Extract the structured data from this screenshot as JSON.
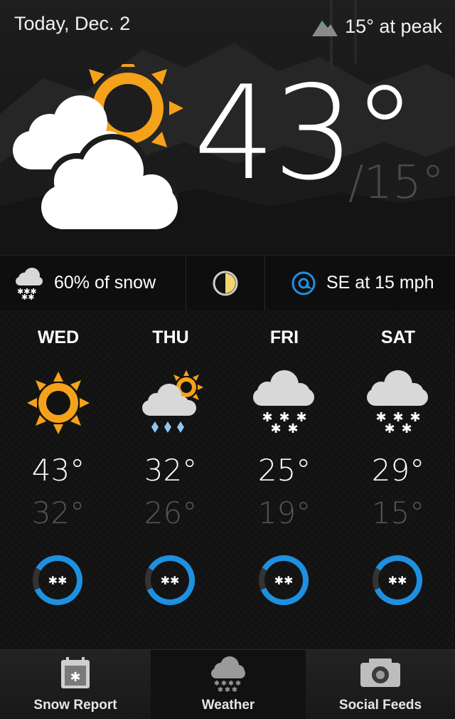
{
  "header": {
    "date": "Today, Dec. 2",
    "peak": "15° at peak",
    "peak_icon": "mountain-icon"
  },
  "current": {
    "condition_icon": "partly-cloudy-icon",
    "high": "43°",
    "low": "/15°"
  },
  "stats": {
    "snow_chance": "60% of snow",
    "snow_icon": "snow-cloud-icon",
    "moon_icon": "half-moon-icon",
    "wind": "SE at 15 mph",
    "wind_icon": "wind-direction-icon"
  },
  "forecast": [
    {
      "day": "WED",
      "icon": "sun-icon",
      "high": "43°",
      "low": "32°",
      "snow_level": 0.85
    },
    {
      "day": "THU",
      "icon": "rain-sun-icon",
      "high": "32°",
      "low": "26°",
      "snow_level": 0.85
    },
    {
      "day": "FRI",
      "icon": "snow-icon",
      "high": "25°",
      "low": "19°",
      "snow_level": 0.85
    },
    {
      "day": "SAT",
      "icon": "snow-icon",
      "high": "29°",
      "low": "15°",
      "snow_level": 0.85
    }
  ],
  "tabs": [
    {
      "label": "Snow Report",
      "icon": "calendar-snow-icon"
    },
    {
      "label": "Weather",
      "icon": "weather-cloud-icon"
    },
    {
      "label": "Social Feeds",
      "icon": "camera-icon"
    }
  ],
  "colors": {
    "sun": "#F5A21A",
    "accent_blue": "#1E90E0",
    "moon": "#F2D56B"
  }
}
